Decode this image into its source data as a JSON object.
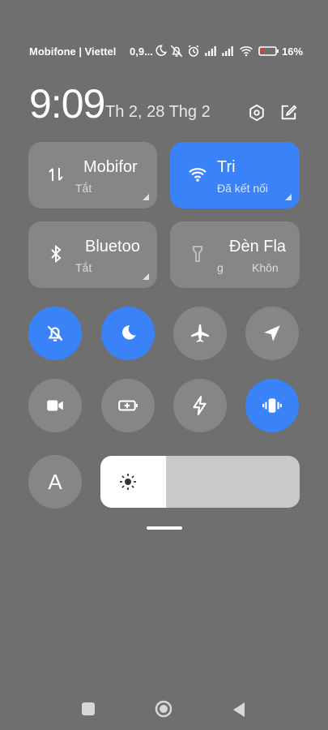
{
  "status_bar": {
    "carrier": "Mobifone | Viettel",
    "speed": "0,9...",
    "battery_percent": "16%",
    "icons": [
      "moon-icon",
      "notifications-off-icon",
      "alarm-icon",
      "signal-icon",
      "signal-icon",
      "wifi-icon",
      "battery-low-icon"
    ]
  },
  "header": {
    "time": "9:09",
    "date": "Th 2, 28 Thg 2",
    "icons": [
      "settings-icon",
      "edit-icon"
    ]
  },
  "tiles": [
    {
      "id": "mobile-data",
      "title": "Mobifor",
      "subtitle": "Tắt",
      "active": false,
      "icon": "data-transfer-icon"
    },
    {
      "id": "wifi",
      "title": "Tri",
      "subtitle": "Đã kết nối",
      "active": true,
      "icon": "wifi-icon"
    },
    {
      "id": "bluetooth",
      "title": "Bluetoo",
      "subtitle": "Tắt",
      "active": false,
      "icon": "bluetooth-icon"
    },
    {
      "id": "flashlight",
      "title": "Đèn Fla",
      "subtitle_left": "g",
      "subtitle": "Khôn",
      "active": false,
      "icon": "flashlight-icon"
    }
  ],
  "toggles_row1": [
    {
      "id": "mute",
      "icon": "bell-off-icon",
      "active": true
    },
    {
      "id": "dnd",
      "icon": "moon-icon",
      "active": true
    },
    {
      "id": "airplane",
      "icon": "airplane-icon",
      "active": false
    },
    {
      "id": "location",
      "icon": "location-icon",
      "active": false
    }
  ],
  "toggles_row2": [
    {
      "id": "screen-record",
      "icon": "video-camera-icon",
      "active": false
    },
    {
      "id": "battery-saver",
      "icon": "battery-saver-icon",
      "active": false
    },
    {
      "id": "performance",
      "icon": "lightning-icon",
      "active": false
    },
    {
      "id": "vibrate",
      "icon": "vibrate-icon",
      "active": true
    }
  ],
  "auto_brightness_label": "A",
  "brightness": {
    "level": 0.33,
    "icon": "sun-icon"
  },
  "nav_bar": [
    "square-recents-icon",
    "circle-home-icon",
    "triangle-back-icon"
  ],
  "colors": {
    "accent": "#3a82f7",
    "tile": "#868686",
    "background": "#6f6f6f"
  }
}
